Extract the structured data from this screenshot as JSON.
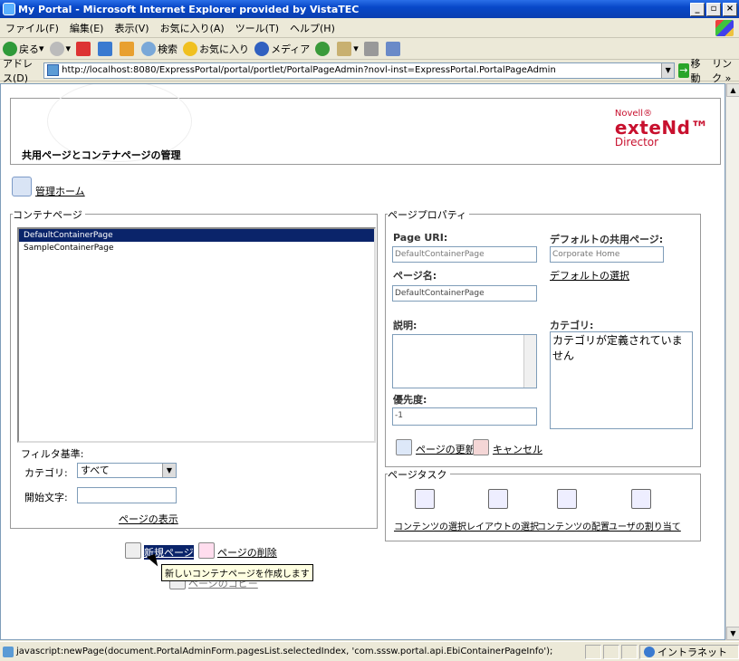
{
  "window": {
    "title": "My Portal - Microsoft Internet Explorer provided by VistaTEC"
  },
  "menubar": {
    "items": [
      "ファイル(F)",
      "編集(E)",
      "表示(V)",
      "お気に入り(A)",
      "ツール(T)",
      "ヘルプ(H)"
    ]
  },
  "toolbar": {
    "back": "戻る",
    "search": "検索",
    "favorites": "お気に入り",
    "media": "メディア"
  },
  "address": {
    "label": "アドレス(D)",
    "url": "http://localhost:8080/ExpressPortal/portal/portlet/PortalPageAdmin?novl-inst=ExpressPortal.PortalPageAdmin",
    "go": "移動",
    "links": "リンク »"
  },
  "banner": {
    "page_title": "共用ページとコンテナページの管理",
    "logo_novell": "Novell®",
    "logo_extend": "exteNd™",
    "logo_director": "Director"
  },
  "nav": {
    "home_link": "管理ホーム"
  },
  "container_pages": {
    "legend": "コンテナページ",
    "items": [
      {
        "label": "DefaultContainerPage",
        "selected": true
      },
      {
        "label": "SampleContainerPage",
        "selected": false
      }
    ],
    "filter_label": "フィルタ基準:",
    "category_label": "カテゴリ:",
    "category_value": "すべて",
    "start_char_label": "開始文字:",
    "start_char_value": "",
    "show_pages_link": "ページの表示"
  },
  "page_properties": {
    "legend": "ページプロパティ",
    "page_uri_label": "Page URI:",
    "page_uri_value": "DefaultContainerPage",
    "default_shared_label": "デフォルトの共用ページ:",
    "default_shared_value": "Corporate Home",
    "select_default_link": "デフォルトの選択",
    "page_name_label": "ページ名:",
    "page_name_value": "DefaultContainerPage",
    "description_label": "説明:",
    "category_label": "カテゴリ:",
    "category_empty": "カテゴリが定義されていません",
    "priority_label": "優先度:",
    "priority_value": "-1",
    "update_link": "ページの更新",
    "cancel_link": "キャンセル"
  },
  "page_tasks": {
    "legend": "ページタスク",
    "items": [
      "コンテンツの選択",
      "レイアウトの選択",
      "コンテンツの配置",
      "ユーザの割り当て"
    ]
  },
  "actions": {
    "new_page": "新規ページ",
    "delete_page": "ページの削除",
    "hidden_link": "ページのコピー"
  },
  "tooltip": {
    "text": "新しいコンテナページを作成します"
  },
  "status": {
    "text": "javascript:newPage(document.PortalAdminForm.pagesList.selectedIndex, 'com.sssw.portal.api.EbiContainerPageInfo');",
    "zone": "イントラネット"
  }
}
